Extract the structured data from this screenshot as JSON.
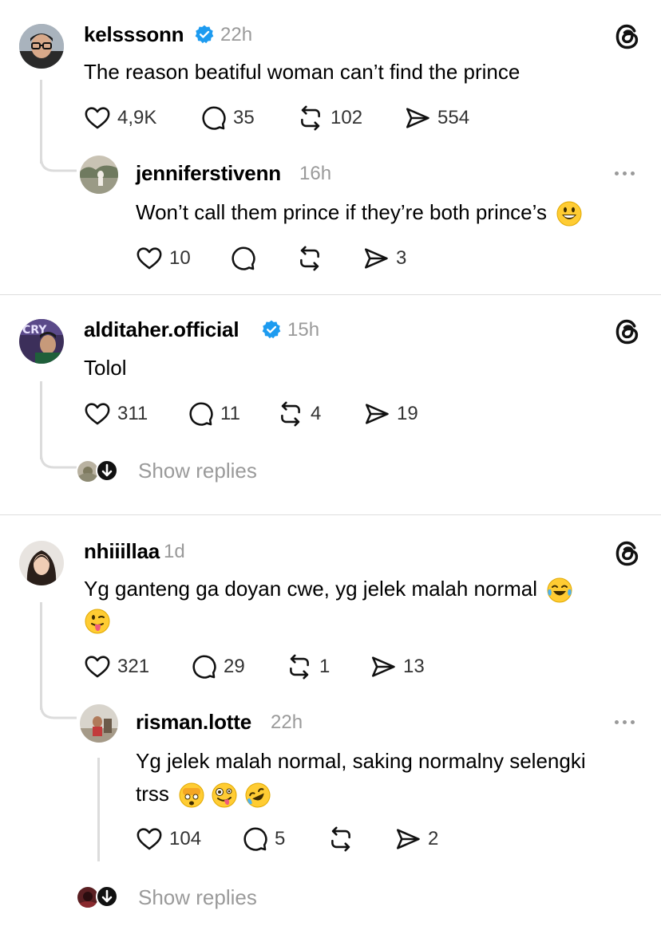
{
  "posts": [
    {
      "username": "kelsssonn",
      "time": "22h",
      "text": "The reason beatiful woman can’t find the prince",
      "likes": "4,9K",
      "comments": "35",
      "reposts": "102",
      "shares": "554",
      "verified": true,
      "reply": {
        "username": "jenniferstivenn",
        "time": "16h",
        "text": "Won’t call them prince if they’re both prince’s",
        "likes": "10",
        "comments": "",
        "reposts": "",
        "shares": "3"
      }
    },
    {
      "username": "alditaher.official",
      "time": "15h",
      "text": "Tolol",
      "likes": "311",
      "comments": "11",
      "reposts": "4",
      "shares": "19",
      "verified": true,
      "show_replies": "Show replies"
    },
    {
      "username": "nhiiillaa",
      "time": "1d",
      "text": "Yg ganteng ga doyan cwe, yg jelek malah normal",
      "likes": "321",
      "comments": "29",
      "reposts": "1",
      "shares": "13",
      "verified": false,
      "reply": {
        "username": "risman.lotte",
        "time": "22h",
        "text_line1": "Yg jelek malah normal, saking normalny selengki",
        "text_line2": "trss",
        "likes": "104",
        "comments": "5",
        "reposts": "",
        "shares": "2"
      },
      "show_replies": "Show replies"
    }
  ],
  "icons": {
    "like": "heart-icon",
    "comment": "comment-icon",
    "repost": "repost-icon",
    "share": "share-icon",
    "verified": "verified-badge-icon",
    "threads": "threads-logo-icon",
    "more": "more-options-icon"
  },
  "colors": {
    "verified": "#1d9bf0",
    "muted": "#9a9a9a",
    "divider": "#dedede"
  }
}
